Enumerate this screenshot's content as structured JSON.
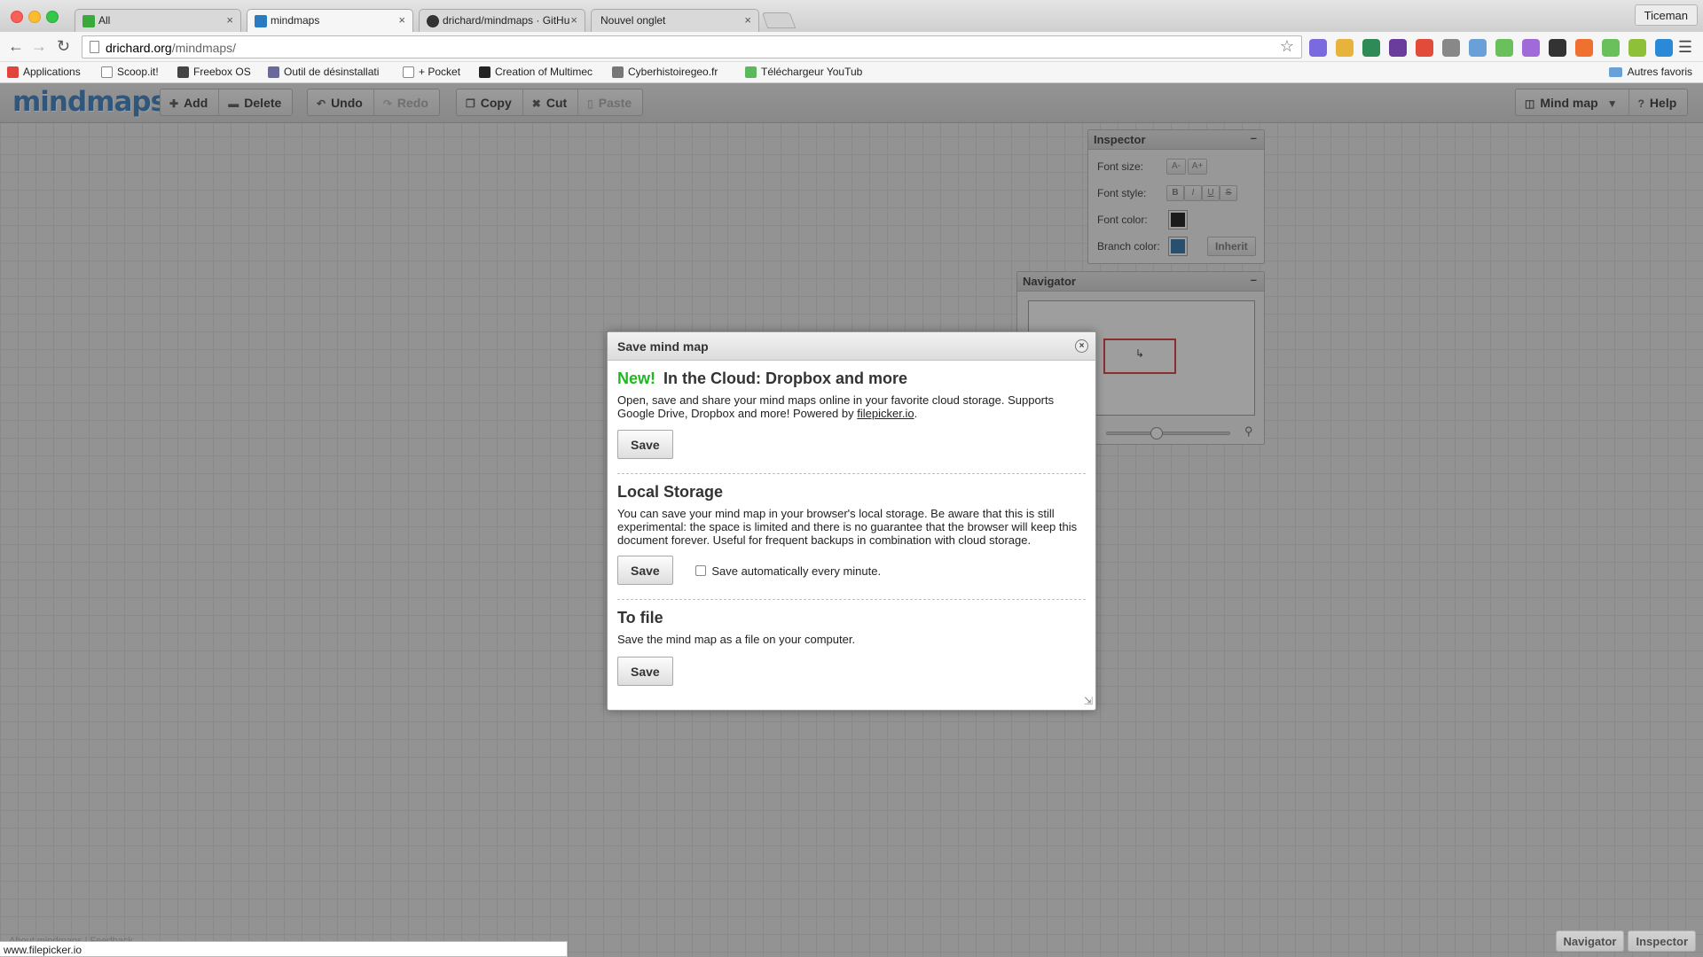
{
  "browser": {
    "tabs": [
      {
        "title": "All",
        "close": "×",
        "favicon_color": "#3aa83a"
      },
      {
        "title": "mindmaps",
        "close": "×",
        "favicon_color": "#2b7bc0"
      },
      {
        "title": "drichard/mindmaps · GitHu",
        "close": "×",
        "favicon_color": "#333333"
      },
      {
        "title": "Nouvel onglet",
        "close": "×",
        "favicon_color": "#d9d9d9"
      }
    ],
    "user": "Ticeman",
    "url_host": "drichard.org",
    "url_path": "/mindmaps/",
    "bookmarks": [
      {
        "label": "Applications",
        "color": "#e0443c"
      },
      {
        "label": "Scoop.it!",
        "color": "#888888"
      },
      {
        "label": "Freebox OS",
        "color": "#444444"
      },
      {
        "label": "Outil de désinstallati",
        "color": "#6a6a9a"
      },
      {
        "label": "+ Pocket",
        "color": "#999999"
      },
      {
        "label": "Creation of Multimec",
        "color": "#222222"
      },
      {
        "label": "Cyberhistoiregeo.fr",
        "color": "#777777"
      },
      {
        "label": "Téléchargeur YouTub",
        "color": "#5cb85c"
      }
    ],
    "other_bookmarks": "Autres favoris",
    "extension_colors": [
      "#7a6ae0",
      "#e8b33a",
      "#2e8b57",
      "#6a3c9c",
      "#e24b3a",
      "#888888",
      "#6aa0d8",
      "#6ac05a",
      "#a06ad8",
      "#333333",
      "#f07030",
      "#6ac05a",
      "#8fc03a",
      "#2b8ad8"
    ]
  },
  "app": {
    "logo": "mindmaps",
    "toolbar": {
      "add": "Add",
      "delete": "Delete",
      "undo": "Undo",
      "redo": "Redo",
      "copy": "Copy",
      "cut": "Cut",
      "paste": "Paste",
      "mindmap_menu": "Mind map",
      "help": "Help"
    },
    "inspector": {
      "title": "Inspector",
      "collapse": "–",
      "font_size_label": "Font size:",
      "font_size_dec": "A-",
      "font_size_inc": "A+",
      "font_style_label": "Font style:",
      "bold": "B",
      "italic": "I",
      "underline": "U",
      "strike": "S",
      "font_color_label": "Font color:",
      "font_color": "#111111",
      "branch_color_label": "Branch color:",
      "branch_color": "#2a6fa8",
      "inherit": "Inherit"
    },
    "navigator": {
      "title": "Navigator",
      "collapse": "–",
      "zoom": 0.4
    },
    "bottom": {
      "navigator": "Navigator",
      "inspector": "Inspector",
      "footer": "About mindmaps  |  Feedback"
    }
  },
  "dialog": {
    "title": "Save mind map",
    "close": "×",
    "cloud": {
      "new": "New!",
      "heading": "In the Cloud: Dropbox and more",
      "text_before": "Open, save and share your mind maps online in your favorite cloud storage. Supports Google Drive, Dropbox and more! Powered by ",
      "link": "filepicker.io",
      "text_after": ".",
      "button": "Save"
    },
    "local": {
      "heading": "Local Storage",
      "text": "You can save your mind map in your browser's local storage. Be aware that this is still experimental: the space is limited and there is no guarantee that the browser will keep this document forever. Useful for frequent backups in combination with cloud storage.",
      "button": "Save",
      "autosave_label": "Save automatically every minute.",
      "autosave_checked": false
    },
    "file": {
      "heading": "To file",
      "text": "Save the mind map as a file on your computer.",
      "button": "Save"
    }
  },
  "statusbar": "www.filepicker.io"
}
